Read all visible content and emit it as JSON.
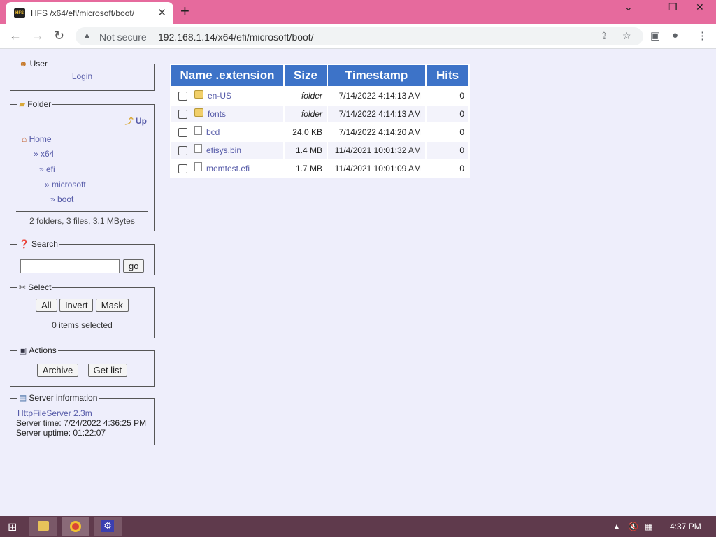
{
  "browser": {
    "tab_title": "HFS /x64/efi/microsoft/boot/",
    "tab_close": "✕",
    "new_tab": "+",
    "security_label": "Not secure",
    "url": "192.168.1.14/x64/efi/microsoft/boot/",
    "favicon_text": "HFS"
  },
  "user_panel": {
    "title": "User",
    "login": "Login"
  },
  "folder_panel": {
    "title": "Folder",
    "up": "Up",
    "breadcrumbs": [
      "Home",
      "» x64",
      "» efi",
      "» microsoft",
      "» boot"
    ],
    "summary": "2 folders, 3 files, 3.1 MBytes"
  },
  "search_panel": {
    "title": "Search",
    "placeholder": "",
    "go": "go"
  },
  "select_panel": {
    "title": "Select",
    "buttons": [
      "All",
      "Invert",
      "Mask"
    ],
    "status": "0 items selected"
  },
  "actions_panel": {
    "title": "Actions",
    "archive": "Archive",
    "get_list": "Get list"
  },
  "server_panel": {
    "title": "Server information",
    "software": "HttpFileServer 2.3m",
    "time": "Server time: 7/24/2022 4:36:25 PM",
    "uptime": "Server uptime: 01:22:07"
  },
  "files_table": {
    "headers": [
      "Name .extension",
      "Size",
      "Timestamp",
      "Hits"
    ],
    "rows": [
      {
        "name": "en-US",
        "type": "folder",
        "size": "folder",
        "timestamp": "7/14/2022 4:14:13 AM",
        "hits": "0"
      },
      {
        "name": "fonts",
        "type": "folder",
        "size": "folder",
        "timestamp": "7/14/2022 4:14:13 AM",
        "hits": "0"
      },
      {
        "name": "bcd",
        "type": "file",
        "size": "24.0 KB",
        "timestamp": "7/14/2022 4:14:20 AM",
        "hits": "0"
      },
      {
        "name": "efisys.bin",
        "type": "file",
        "size": "1.4 MB",
        "timestamp": "11/4/2021 10:01:32 AM",
        "hits": "0"
      },
      {
        "name": "memtest.efi",
        "type": "file",
        "size": "1.7 MB",
        "timestamp": "11/4/2021 10:01:09 AM",
        "hits": "0"
      }
    ]
  },
  "taskbar": {
    "clock": "4:37 PM"
  },
  "colors": {
    "tabbar": "#e66a9d",
    "table_header": "#3d73c8",
    "page_bg": "#eeeefb",
    "taskbar": "#5f3a4c",
    "link": "#555aa8"
  }
}
